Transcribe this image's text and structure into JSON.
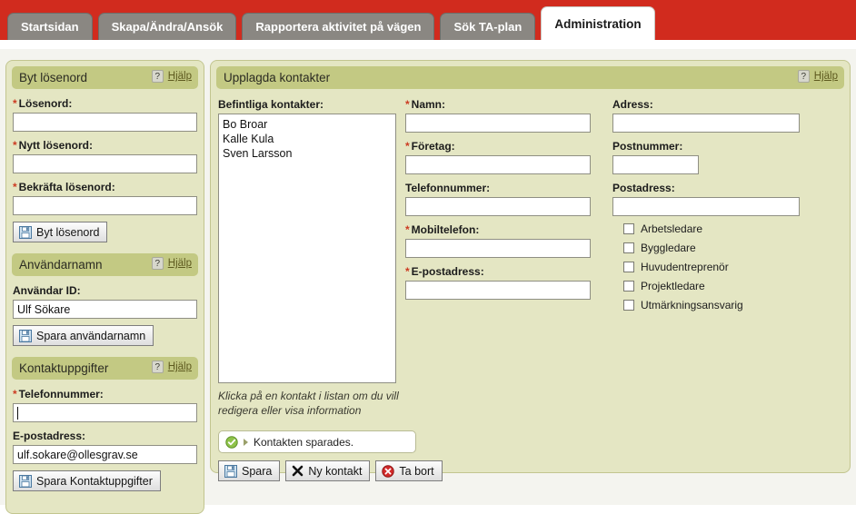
{
  "colors": {
    "header_red": "#d12b1e",
    "tab_inactive": "#8a8782",
    "tab_active": "#ffffff",
    "panel_bg": "#e4e6c3",
    "panel_header": "#c3c983",
    "required_asterisk": "#cc3b22",
    "status_ok_green": "#5aa02c",
    "delete_red": "#cc2222"
  },
  "tabs": [
    {
      "label": "Startsidan",
      "active": false
    },
    {
      "label": "Skapa/Ändra/Ansök",
      "active": false
    },
    {
      "label": "Rapportera aktivitet på vägen",
      "active": false
    },
    {
      "label": "Sök TA-plan",
      "active": false
    },
    {
      "label": "Administration",
      "active": true
    }
  ],
  "help": {
    "icon": "question-mark-icon",
    "label": "Hjälp"
  },
  "left_panel": {
    "password": {
      "title": "Byt lösenord",
      "fields": [
        {
          "label": "Lösenord:",
          "required": true,
          "value": "",
          "focused": false
        },
        {
          "label": "Nytt lösenord:",
          "required": true,
          "value": "",
          "focused": false
        },
        {
          "label": "Bekräfta lösenord:",
          "required": true,
          "value": "",
          "focused": false
        }
      ],
      "save_button": {
        "label": "Byt lösenord",
        "icon": "save-floppy-icon"
      }
    },
    "username": {
      "title": "Användarnamn",
      "field": {
        "label": "Användar ID:",
        "required": false,
        "value": "Ulf Sökare",
        "focused": false
      },
      "save_button": {
        "label": "Spara användarnamn",
        "icon": "save-floppy-icon"
      }
    },
    "contact_details": {
      "title": "Kontaktuppgifter",
      "fields": [
        {
          "label": "Telefonnummer:",
          "required": true,
          "value": "",
          "focused": true
        },
        {
          "label": "E-postadress:",
          "required": false,
          "value": "ulf.sokare@ollesgrav.se",
          "focused": false
        }
      ],
      "save_button": {
        "label": "Spara Kontaktuppgifter",
        "icon": "save-floppy-icon"
      }
    }
  },
  "main_panel": {
    "title": "Upplagda kontakter",
    "list": {
      "label": "Befintliga kontakter:",
      "items": [
        "Bo Broar",
        "Kalle Kula",
        "Sven Larsson"
      ],
      "hint": "Klicka på en kontakt i listan om du vill redigera eller visa information"
    },
    "middle_fields": [
      {
        "label": "Namn:",
        "required": true,
        "value": ""
      },
      {
        "label": "Företag:",
        "required": true,
        "value": ""
      },
      {
        "label": "Telefonnummer:",
        "required": false,
        "value": ""
      },
      {
        "label": "Mobiltelefon:",
        "required": true,
        "value": ""
      },
      {
        "label": "E-postadress:",
        "required": true,
        "value": ""
      }
    ],
    "right_fields": [
      {
        "label": "Adress:",
        "required": false,
        "value": "",
        "short": false
      },
      {
        "label": "Postnummer:",
        "required": false,
        "value": "",
        "short": true
      },
      {
        "label": "Postadress:",
        "required": false,
        "value": "",
        "short": false
      }
    ],
    "roles": [
      {
        "label": "Arbetsledare",
        "checked": false
      },
      {
        "label": "Byggledare",
        "checked": false
      },
      {
        "label": "Huvudentreprenör",
        "checked": false
      },
      {
        "label": "Projektledare",
        "checked": false
      },
      {
        "label": "Utmärkningsansvarig",
        "checked": false
      }
    ],
    "status": {
      "icon": "green-check-circle-icon",
      "text": "Kontakten sparades."
    },
    "buttons": [
      {
        "label": "Spara",
        "icon": "save-floppy-icon"
      },
      {
        "label": "Ny kontakt",
        "icon": "x-mark-icon"
      },
      {
        "label": "Ta bort",
        "icon": "red-delete-circle-icon"
      }
    ]
  }
}
